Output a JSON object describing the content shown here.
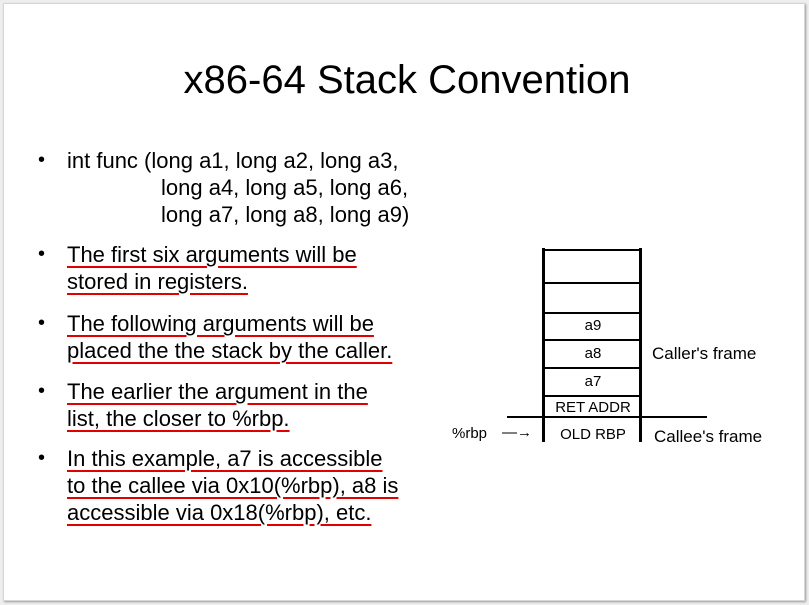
{
  "slide": {
    "title": "x86-64 Stack Convention",
    "bullets": [
      {
        "lines": [
          "int func (long a1, long a2, long a3,",
          "long a4, long a5, long a6,",
          "long a7, long a8, long a9)"
        ],
        "underlined": false
      },
      {
        "lines": [
          "The first six arguments will be",
          "stored in registers."
        ],
        "underlined": true
      },
      {
        "lines": [
          "The following arguments will be",
          "placed the the stack by the caller."
        ],
        "underlined": true
      },
      {
        "lines": [
          "The earlier the argument in the",
          "list, the closer to %rbp."
        ],
        "underlined": true
      },
      {
        "lines": [
          "In this example, a7 is accessible",
          "to the callee via 0x10(%rbp), a8 is",
          "accessible via 0x18(%rbp), etc."
        ],
        "underlined": true
      }
    ],
    "underline_color": "#e00000"
  },
  "stack_diagram": {
    "cells": [
      "",
      "",
      "a9",
      "a8",
      "a7",
      "RET ADDR",
      "OLD RBP"
    ],
    "callers_frame_label": "Caller's frame",
    "callees_frame_label": "Callee's frame",
    "pointer_label": "%rbp",
    "pointer_arrow": "—→"
  }
}
